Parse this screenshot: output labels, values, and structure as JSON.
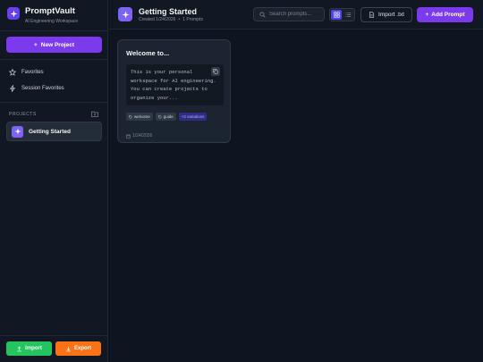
{
  "app": {
    "title": "PromptVault",
    "subtitle": "AI Engineering Workspace"
  },
  "sidebar": {
    "new_project_label": "New Project",
    "nav": [
      {
        "label": "Favorites",
        "icon": "star-icon"
      },
      {
        "label": "Session Favorites",
        "icon": "bolt-icon"
      }
    ],
    "projects_header": "PROJECTS",
    "projects": [
      {
        "label": "Getting Started"
      }
    ],
    "import_label": "Import",
    "export_label": "Export"
  },
  "header": {
    "title": "Getting Started",
    "created": "Created 1/24/2026",
    "separator": "•",
    "prompt_count": "1 Prompts",
    "search_placeholder": "Search prompts...",
    "import_txt_label": "Import .txt",
    "add_prompt_label": "Add Prompt"
  },
  "cards": [
    {
      "title": "Welcome to...",
      "body": "This is your personal workspace for AI engineering. You can create projects to organize your...",
      "tags": [
        "welcome",
        "guide"
      ],
      "variations": "+2 variations",
      "date": "1/24/2026"
    }
  ],
  "colors": {
    "accent": "#7c3aed",
    "import": "#22c55e",
    "export": "#f97316",
    "background": "#0f1520"
  }
}
